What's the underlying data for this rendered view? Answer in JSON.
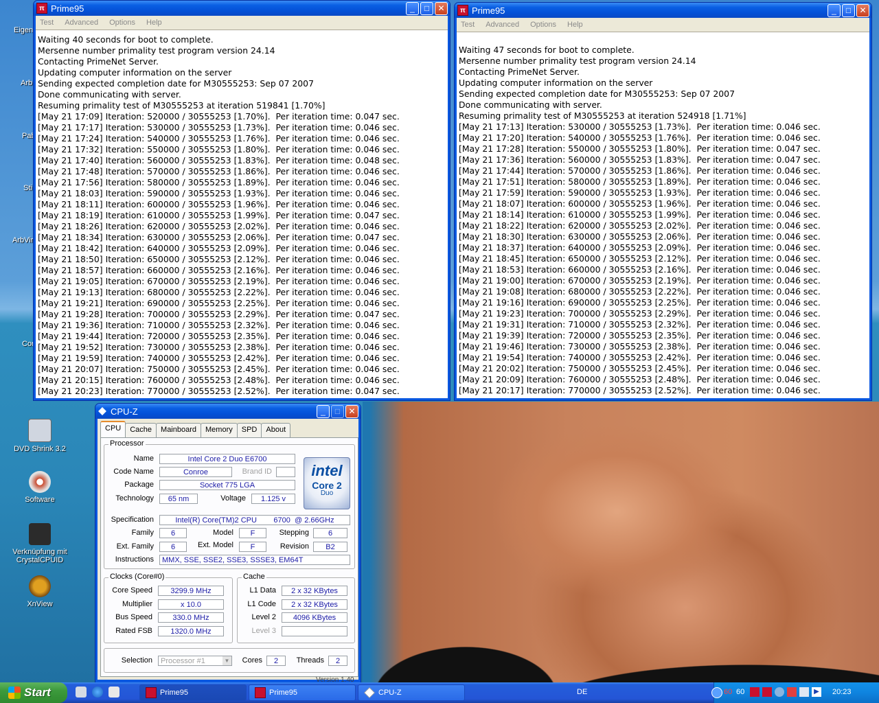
{
  "desktop": {
    "icons": [
      {
        "label": "DVD Shrink 3.2",
        "color": "#d0d6e0"
      },
      {
        "label": "Software",
        "color": "#c94a2e"
      },
      {
        "label": "Verknüpfung mit CrystalCPUID",
        "color": "#2b2b2b"
      },
      {
        "label": "XnView",
        "color": "#e0a020"
      }
    ],
    "partial_labels": [
      "Eigen",
      "Arb",
      "Pab",
      "Sti",
      "ArbVir",
      "Cor"
    ]
  },
  "prime_left": {
    "title": "Prime95",
    "menu": [
      "Test",
      "Advanced",
      "Options",
      "Help"
    ],
    "lines": [
      "Waiting 40 seconds for boot to complete.",
      "Mersenne number primality test program version 24.14",
      "Contacting PrimeNet Server.",
      "Updating computer information on the server",
      "Sending expected completion date for M30555253: Sep 07 2007",
      "Done communicating with server.",
      "Resuming primality test of M30555253 at iteration 519841 [1.70%]",
      "[May 21 17:09] Iteration: 520000 / 30555253 [1.70%].  Per iteration time: 0.047 sec.",
      "[May 21 17:17] Iteration: 530000 / 30555253 [1.73%].  Per iteration time: 0.046 sec.",
      "[May 21 17:24] Iteration: 540000 / 30555253 [1.76%].  Per iteration time: 0.046 sec.",
      "[May 21 17:32] Iteration: 550000 / 30555253 [1.80%].  Per iteration time: 0.046 sec.",
      "[May 21 17:40] Iteration: 560000 / 30555253 [1.83%].  Per iteration time: 0.048 sec.",
      "[May 21 17:48] Iteration: 570000 / 30555253 [1.86%].  Per iteration time: 0.046 sec.",
      "[May 21 17:56] Iteration: 580000 / 30555253 [1.89%].  Per iteration time: 0.046 sec.",
      "[May 21 18:03] Iteration: 590000 / 30555253 [1.93%].  Per iteration time: 0.046 sec.",
      "[May 21 18:11] Iteration: 600000 / 30555253 [1.96%].  Per iteration time: 0.046 sec.",
      "[May 21 18:19] Iteration: 610000 / 30555253 [1.99%].  Per iteration time: 0.047 sec.",
      "[May 21 18:26] Iteration: 620000 / 30555253 [2.02%].  Per iteration time: 0.046 sec.",
      "[May 21 18:34] Iteration: 630000 / 30555253 [2.06%].  Per iteration time: 0.047 sec.",
      "[May 21 18:42] Iteration: 640000 / 30555253 [2.09%].  Per iteration time: 0.046 sec.",
      "[May 21 18:50] Iteration: 650000 / 30555253 [2.12%].  Per iteration time: 0.046 sec.",
      "[May 21 18:57] Iteration: 660000 / 30555253 [2.16%].  Per iteration time: 0.046 sec.",
      "[May 21 19:05] Iteration: 670000 / 30555253 [2.19%].  Per iteration time: 0.046 sec.",
      "[May 21 19:13] Iteration: 680000 / 30555253 [2.22%].  Per iteration time: 0.046 sec.",
      "[May 21 19:21] Iteration: 690000 / 30555253 [2.25%].  Per iteration time: 0.046 sec.",
      "[May 21 19:28] Iteration: 700000 / 30555253 [2.29%].  Per iteration time: 0.047 sec.",
      "[May 21 19:36] Iteration: 710000 / 30555253 [2.32%].  Per iteration time: 0.046 sec.",
      "[May 21 19:44] Iteration: 720000 / 30555253 [2.35%].  Per iteration time: 0.046 sec.",
      "[May 21 19:52] Iteration: 730000 / 30555253 [2.38%].  Per iteration time: 0.046 sec.",
      "[May 21 19:59] Iteration: 740000 / 30555253 [2.42%].  Per iteration time: 0.046 sec.",
      "[May 21 20:07] Iteration: 750000 / 30555253 [2.45%].  Per iteration time: 0.046 sec.",
      "[May 21 20:15] Iteration: 760000 / 30555253 [2.48%].  Per iteration time: 0.046 sec.",
      "[May 21 20:23] Iteration: 770000 / 30555253 [2.52%].  Per iteration time: 0.047 sec."
    ]
  },
  "prime_right": {
    "title": "Prime95",
    "menu": [
      "Test",
      "Advanced",
      "Options",
      "Help"
    ],
    "lines": [
      "Waiting 47 seconds for boot to complete.",
      "Mersenne number primality test program version 24.14",
      "Contacting PrimeNet Server.",
      "Updating computer information on the server",
      "Sending expected completion date for M30555253: Sep 07 2007",
      "Done communicating with server.",
      "Resuming primality test of M30555253 at iteration 524918 [1.71%]",
      "[May 21 17:13] Iteration: 530000 / 30555253 [1.73%].  Per iteration time: 0.046 sec.",
      "[May 21 17:20] Iteration: 540000 / 30555253 [1.76%].  Per iteration time: 0.046 sec.",
      "[May 21 17:28] Iteration: 550000 / 30555253 [1.80%].  Per iteration time: 0.047 sec.",
      "[May 21 17:36] Iteration: 560000 / 30555253 [1.83%].  Per iteration time: 0.047 sec.",
      "[May 21 17:44] Iteration: 570000 / 30555253 [1.86%].  Per iteration time: 0.046 sec.",
      "[May 21 17:51] Iteration: 580000 / 30555253 [1.89%].  Per iteration time: 0.046 sec.",
      "[May 21 17:59] Iteration: 590000 / 30555253 [1.93%].  Per iteration time: 0.046 sec.",
      "[May 21 18:07] Iteration: 600000 / 30555253 [1.96%].  Per iteration time: 0.046 sec.",
      "[May 21 18:14] Iteration: 610000 / 30555253 [1.99%].  Per iteration time: 0.046 sec.",
      "[May 21 18:22] Iteration: 620000 / 30555253 [2.02%].  Per iteration time: 0.046 sec.",
      "[May 21 18:30] Iteration: 630000 / 30555253 [2.06%].  Per iteration time: 0.046 sec.",
      "[May 21 18:37] Iteration: 640000 / 30555253 [2.09%].  Per iteration time: 0.046 sec.",
      "[May 21 18:45] Iteration: 650000 / 30555253 [2.12%].  Per iteration time: 0.046 sec.",
      "[May 21 18:53] Iteration: 660000 / 30555253 [2.16%].  Per iteration time: 0.046 sec.",
      "[May 21 19:00] Iteration: 670000 / 30555253 [2.19%].  Per iteration time: 0.046 sec.",
      "[May 21 19:08] Iteration: 680000 / 30555253 [2.22%].  Per iteration time: 0.046 sec.",
      "[May 21 19:16] Iteration: 690000 / 30555253 [2.25%].  Per iteration time: 0.046 sec.",
      "[May 21 19:23] Iteration: 700000 / 30555253 [2.29%].  Per iteration time: 0.046 sec.",
      "[May 21 19:31] Iteration: 710000 / 30555253 [2.32%].  Per iteration time: 0.046 sec.",
      "[May 21 19:39] Iteration: 720000 / 30555253 [2.35%].  Per iteration time: 0.046 sec.",
      "[May 21 19:46] Iteration: 730000 / 30555253 [2.38%].  Per iteration time: 0.046 sec.",
      "[May 21 19:54] Iteration: 740000 / 30555253 [2.42%].  Per iteration time: 0.046 sec.",
      "[May 21 20:02] Iteration: 750000 / 30555253 [2.45%].  Per iteration time: 0.046 sec.",
      "[May 21 20:09] Iteration: 760000 / 30555253 [2.48%].  Per iteration time: 0.046 sec.",
      "[May 21 20:17] Iteration: 770000 / 30555253 [2.52%].  Per iteration time: 0.046 sec."
    ]
  },
  "cpuz": {
    "title": "CPU-Z",
    "tabs": [
      "CPU",
      "Cache",
      "Mainboard",
      "Memory",
      "SPD",
      "About"
    ],
    "processor_group": "Processor",
    "name_label": "Name",
    "name": "Intel Core 2 Duo E6700",
    "codename_label": "Code Name",
    "codename": "Conroe",
    "brandid_label": "Brand ID",
    "package_label": "Package",
    "package": "Socket 775 LGA",
    "technology_label": "Technology",
    "technology": "65 nm",
    "voltage_label": "Voltage",
    "voltage": "1.125 v",
    "spec_label": "Specification",
    "spec": "Intel(R) Core(TM)2 CPU        6700  @ 2.66GHz",
    "family_label": "Family",
    "family": "6",
    "model_label": "Model",
    "model": "F",
    "stepping_label": "Stepping",
    "stepping": "6",
    "extfamily_label": "Ext. Family",
    "extfamily": "6",
    "extmodel_label": "Ext. Model",
    "extmodel": "F",
    "revision_label": "Revision",
    "revision": "B2",
    "instructions_label": "Instructions",
    "instructions": "MMX, SSE, SSE2, SSE3, SSSE3, EM64T",
    "logo": {
      "brand": "intel",
      "product": "Core 2",
      "sub": "Duo"
    },
    "clocks_group": "Clocks (Core#0)",
    "corespeed_label": "Core Speed",
    "corespeed": "3299.9 MHz",
    "multiplier_label": "Multiplier",
    "multiplier": "x 10.0",
    "busspeed_label": "Bus Speed",
    "busspeed": "330.0 MHz",
    "ratedfsb_label": "Rated FSB",
    "ratedfsb": "1320.0 MHz",
    "cache_group": "Cache",
    "l1data_label": "L1 Data",
    "l1data": "2 x 32 KBytes",
    "l1code_label": "L1 Code",
    "l1code": "2 x 32 KBytes",
    "level2_label": "Level 2",
    "level2": "4096 KBytes",
    "level3_label": "Level 3",
    "selection_label": "Selection",
    "selection": "Processor #1",
    "cores_label": "Cores",
    "cores": "2",
    "threads_label": "Threads",
    "threads": "2",
    "version": "Version 1.40"
  },
  "taskbar": {
    "start": "Start",
    "tasks": [
      "Prime95",
      "Prime95",
      "CPU-Z"
    ],
    "language": "DE",
    "tray_temps": [
      "60",
      "60"
    ],
    "clock": "20:23"
  }
}
